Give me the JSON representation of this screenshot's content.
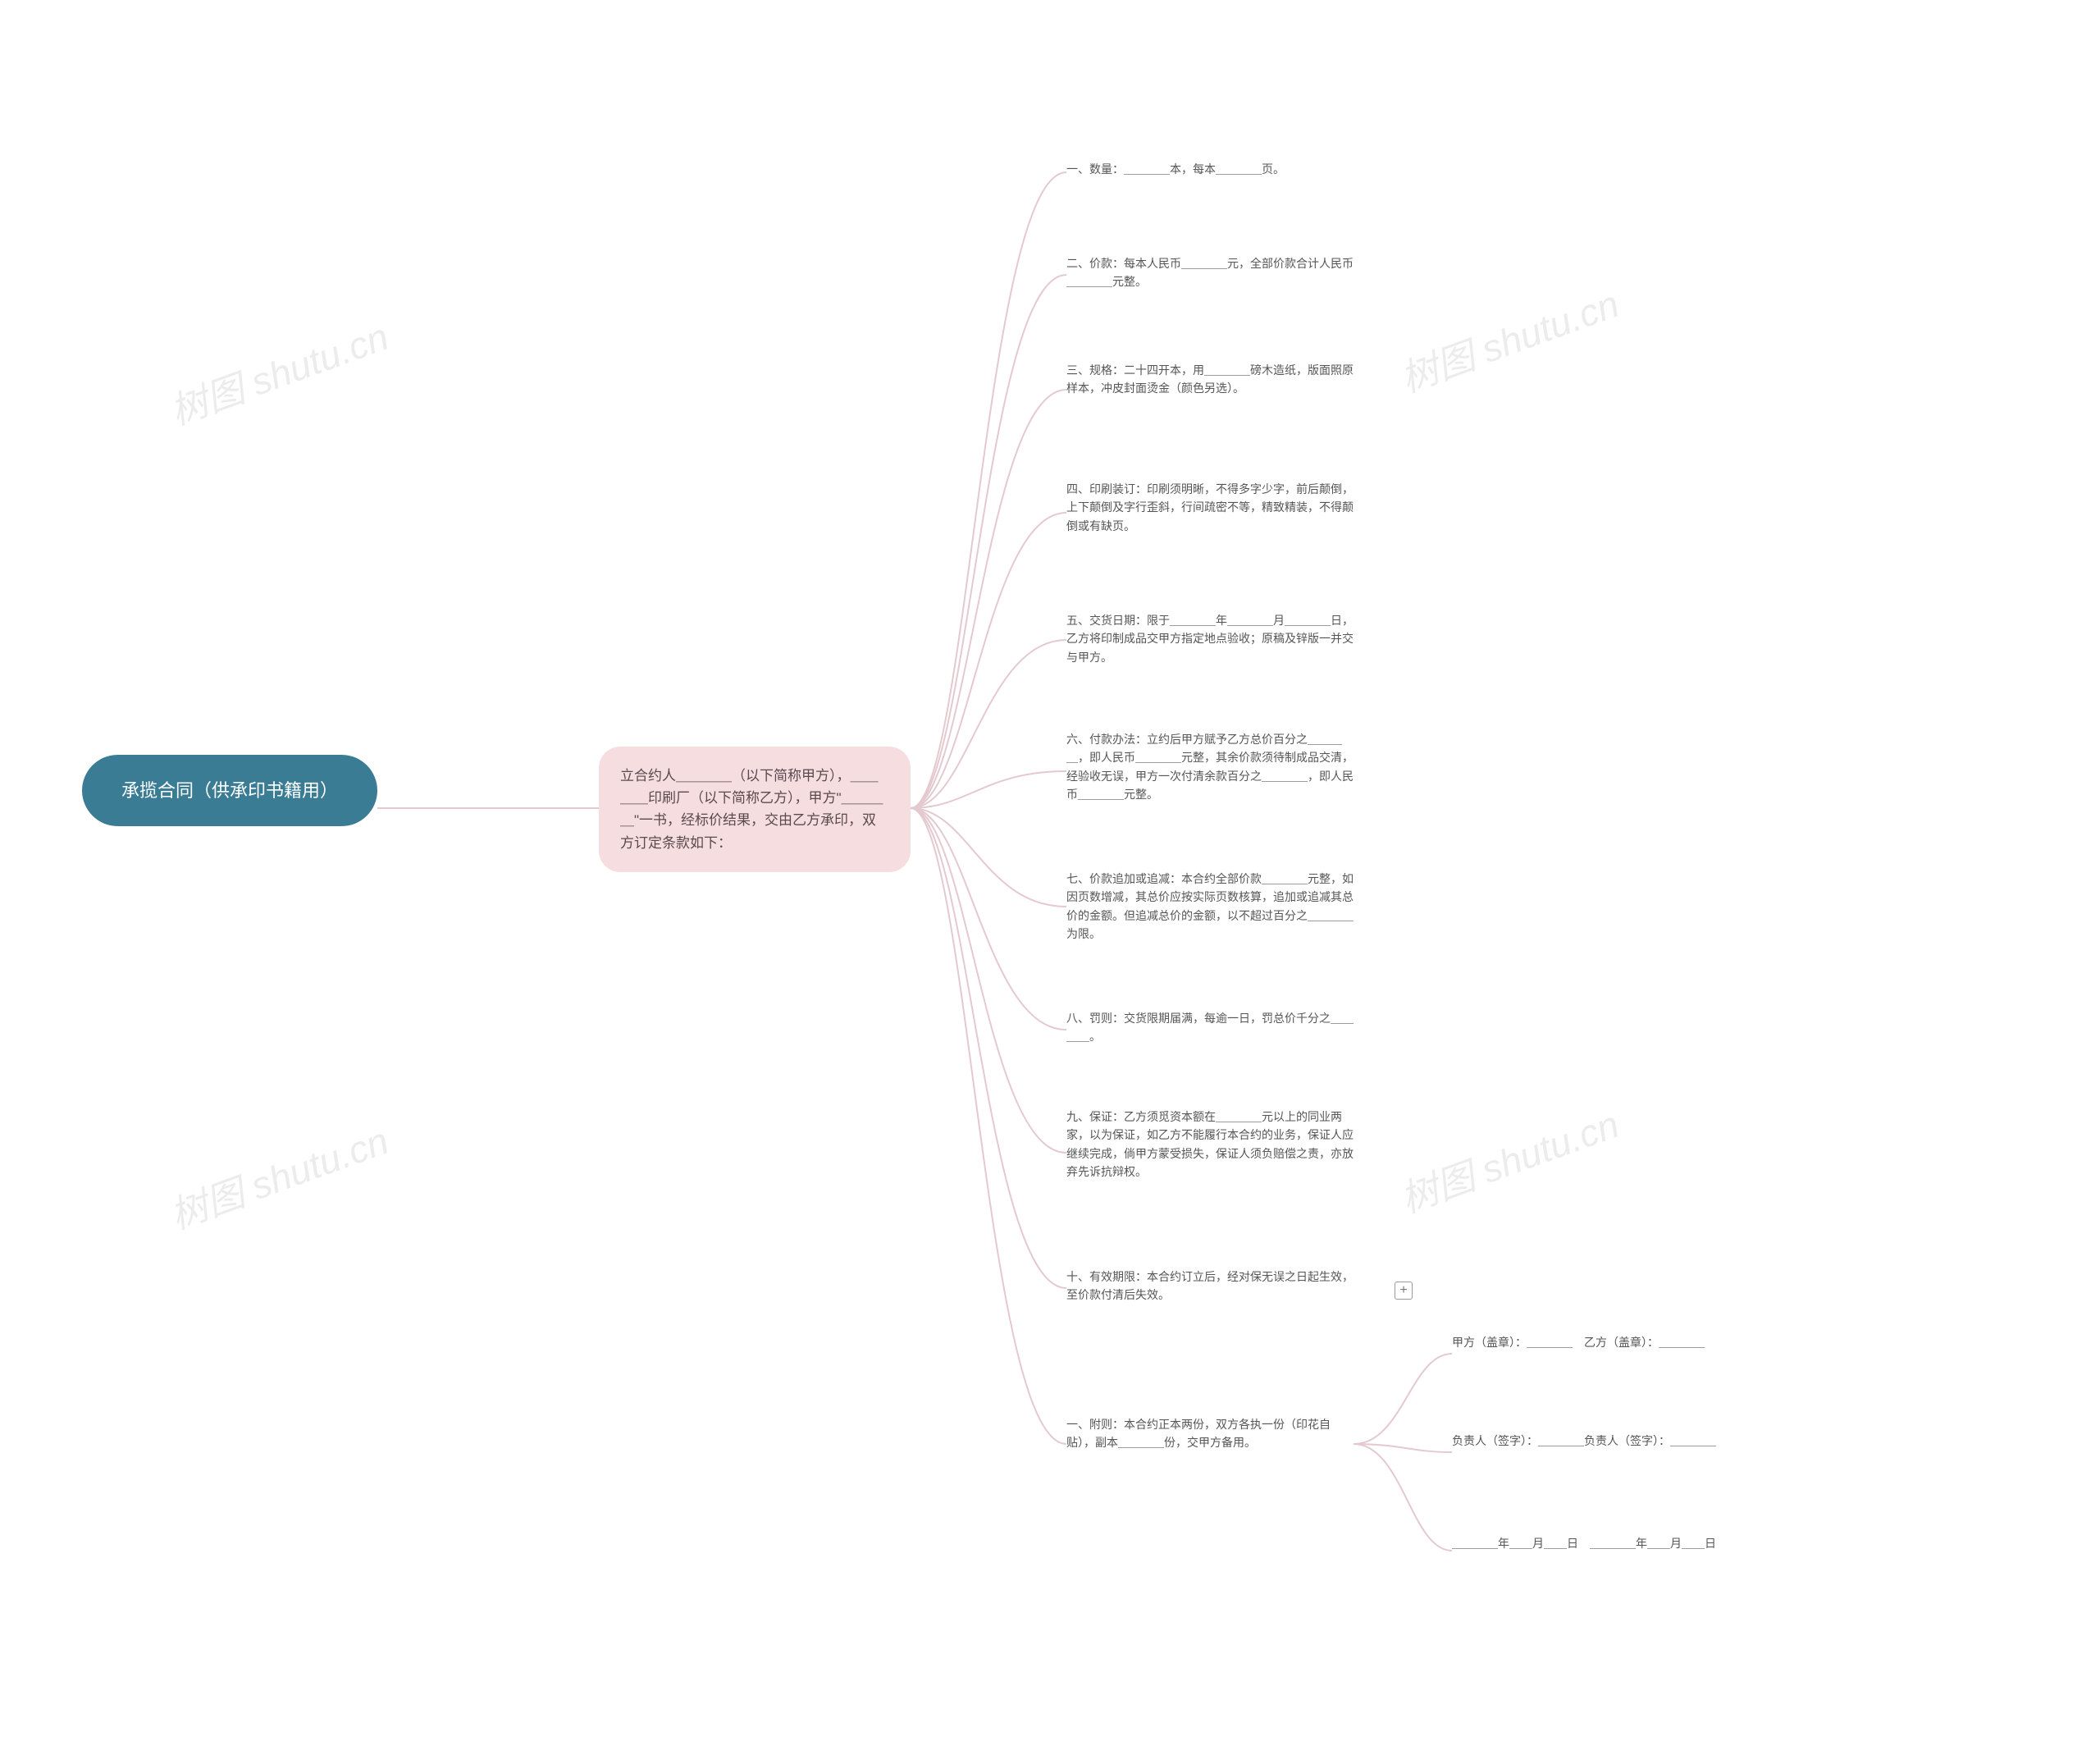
{
  "root": "承揽合同（供承印书籍用）",
  "sub": "立合约人＿＿＿＿（以下简称甲方），＿＿＿＿印刷厂（以下简称乙方），甲方\"＿＿＿＿\"一书，经标价结果，交由乙方承印，双方订定条款如下：",
  "items": [
    "一、数量：＿＿＿＿本，每本＿＿＿＿页。",
    "二、价款：每本人民币＿＿＿＿元，全部价款合计人民币＿＿＿＿元整。",
    "三、规格：二十四开本，用＿＿＿＿磅木造纸，版面照原样本，冲皮封面烫金（颜色另选）。",
    "四、印刷装订：印刷须明晰，不得多字少字，前后颠倒，上下颠倒及字行歪斜，行间疏密不等，精致精装，不得颠倒或有缺页。",
    "五、交货日期：限于＿＿＿＿年＿＿＿＿月＿＿＿＿日，乙方将印制成品交甲方指定地点验收；原稿及锌版一并交与甲方。",
    "六、付款办法：立约后甲方赋予乙方总价百分之＿＿＿＿，即人民币＿＿＿＿元整，其余价款须待制成品交清，经验收无误，甲方一次付清余款百分之＿＿＿＿，即人民币＿＿＿＿元整。",
    "七、价款追加或追减：本合约全部价款＿＿＿＿元整，如因页数增减，其总价应按实际页数核算，追加或追减其总价的金额。但追减总价的金额，以不超过百分之＿＿＿＿为限。",
    "八、罚则：交货限期届满，每逾一日，罚总价千分之＿＿＿＿。",
    "九、保证：乙方须觅资本额在＿＿＿＿元以上的同业两家，以为保证，如乙方不能履行本合约的业务，保证人应继续完成，倘甲方蒙受损失，保证人须负赔偿之责，亦放弃先诉抗辩权。",
    "十、有效期限：本合约订立后，经对保无误之日起生效，至价款付清后失效。",
    "一、附则：本合约正本两份，双方各执一份（印花自贴），副本＿＿＿＿份，交甲方备用。"
  ],
  "leaves": [
    "甲方（盖章）：＿＿＿＿　乙方（盖章）：＿＿＿＿",
    "负责人（签字）：＿＿＿＿负责人（签字）：＿＿＿＿",
    "＿＿＿＿年＿＿月＿＿日　＿＿＿＿年＿＿月＿＿日"
  ],
  "plus": "+",
  "watermark": "树图 shutu.cn"
}
